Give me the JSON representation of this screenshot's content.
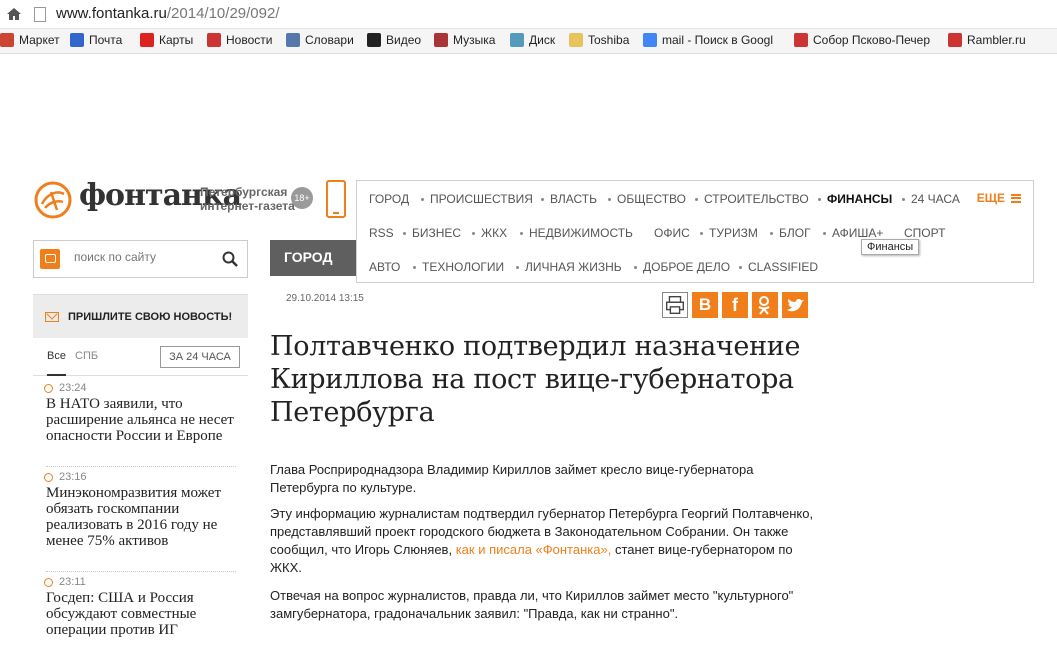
{
  "browser": {
    "url_host": "www.fontanka.ru",
    "url_path": "/2014/10/29/092/",
    "bookmarks": [
      {
        "label": "Маркет",
        "icon": "yandex-market-icon",
        "color": "#c43"
      },
      {
        "label": "Почта",
        "icon": "mail-icon",
        "color": "#36c"
      },
      {
        "label": "Карты",
        "icon": "map-pin-icon",
        "color": "#d22"
      },
      {
        "label": "Новости",
        "icon": "news-icon",
        "color": "#c33"
      },
      {
        "label": "Словари",
        "icon": "dictionary-icon",
        "color": "#57a"
      },
      {
        "label": "Видео",
        "icon": "video-icon",
        "color": "#222"
      },
      {
        "label": "Музыка",
        "icon": "music-icon",
        "color": "#a33"
      },
      {
        "label": "Диск",
        "icon": "disk-icon",
        "color": "#59b"
      },
      {
        "label": "Toshiba",
        "icon": "folder-icon",
        "color": "#e8c35a"
      },
      {
        "label": "mail - Поиск в Googl",
        "icon": "google-icon",
        "color": "#4285f4"
      },
      {
        "label": "Собор Псково-Печер",
        "icon": "yandex-icon",
        "color": "#c33"
      },
      {
        "label": "Rambler.ru",
        "icon": "yandex-icon",
        "color": "#c33"
      }
    ]
  },
  "site": {
    "logo_text": "фонтанка",
    "tagline_1": "Петербургская",
    "tagline_2": "интернет-газета",
    "age": "18+",
    "accent": "#f07f1b"
  },
  "menu": {
    "row1": [
      "ГОРОД",
      "ПРОИСШЕСТВИЯ",
      "ВЛАСТЬ",
      "ОБЩЕСТВО",
      "СТРОИТЕЛЬСТВО",
      "ФИНАНСЫ",
      "24 ЧАСА"
    ],
    "row2": [
      "RSS",
      "БИЗНЕС",
      "ЖКХ",
      "НЕДВИЖИМОСТЬ",
      "ОФИС",
      "ТУРИЗМ",
      "БЛОГ",
      "АФИША+",
      "СПОРТ"
    ],
    "row3": [
      "АВТО",
      "ТЕХНОЛОГИИ",
      "ЛИЧНАЯ ЖИЗНЬ",
      "ДОБРОЕ ДЕЛО",
      "CLASSIFIED"
    ],
    "more": "ЕЩЕ",
    "tooltip": "Финансы"
  },
  "sidebar": {
    "search_placeholder": "поиск по сайту",
    "send_news": "ПРИШЛИТЕ СВОЮ НОВОСТЬ!",
    "tab_all": "Все",
    "tab_spb": "СПБ",
    "tab_24": "ЗА 24 ЧАСА",
    "news": [
      {
        "time": "23:24",
        "title": "В НАТО заявили, что расширение альянса не несет опасности России и Европе"
      },
      {
        "time": "23:16",
        "title": "Минэкономразвития может обязать госкомпании реализовать в 2016 году не менее 75% активов"
      },
      {
        "time": "23:11",
        "title": "Госдеп: США и Россия обсуждают совместные операции против ИГ"
      }
    ]
  },
  "article": {
    "rubric": "ГОРОД",
    "date": "29.10.2014 13:15",
    "headline": "Полтавченко подтвердил назначение Кириллова на пост вице-губернатора Петербурга",
    "p1": "Глава Росприроднадзора Владимир Кириллов займет кресло вице-губернатора Петербурга по культуре.",
    "p2_a": "Эту информацию журналистам подтвердил губернатор Петербурга Георгий Полтавченко, представлявший проект городского бюджета в Законодательном Собрании. Он также сообщил, что Игорь Слюняев, ",
    "p2_link": "как и писала «Фонтанка»,",
    "p2_b": " станет вице-губернатором по ЖКХ.",
    "p3": "Отвечая на вопрос журналистов, правда ли, что Кириллов займет место \"культурного\" замгубернатора, градоначальник заявил: \"Правда, как ни странно\"."
  }
}
